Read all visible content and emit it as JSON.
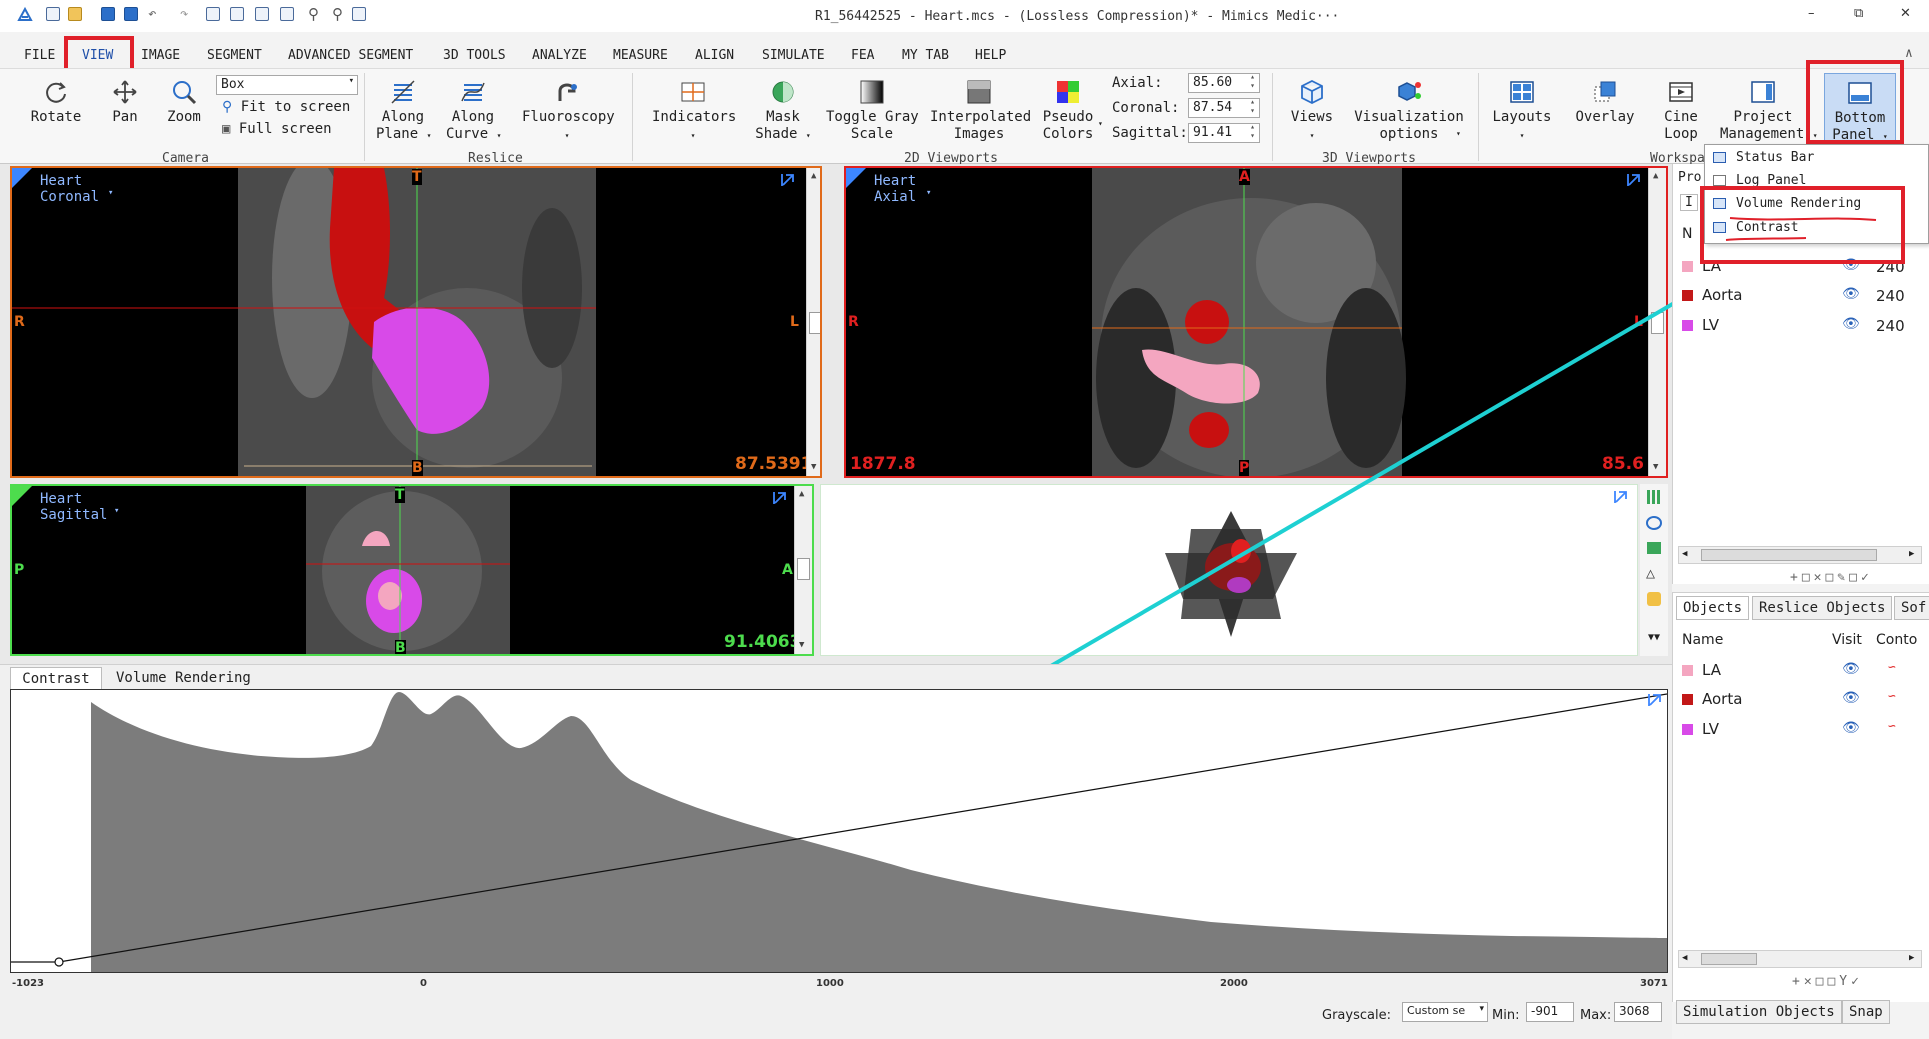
{
  "window": {
    "title": "R1_56442525 - Heart.mcs -  (Lossless Compression)* - Mimics Medic···",
    "minimize": "–",
    "restore": "⧉",
    "close": "✕",
    "collapse": "∧"
  },
  "menu": {
    "items": [
      "FILE",
      "VIEW",
      "IMAGE",
      "SEGMENT",
      "ADVANCED SEGMENT",
      "3D TOOLS",
      "ANALYZE",
      "MEASURE",
      "ALIGN",
      "SIMULATE",
      "FEA",
      "MY TAB",
      "HELP"
    ],
    "active": "VIEW"
  },
  "ribbon": {
    "camera": {
      "rotate": "Rotate",
      "pan": "Pan",
      "zoom": "Zoom",
      "zoom_mode": "Box",
      "fit": "Fit to screen",
      "full": "Full screen",
      "group": "Camera"
    },
    "reslice": {
      "along_plane_1": "Along",
      "along_plane_2": "Plane",
      "along_curve_1": "Along",
      "along_curve_2": "Curve",
      "fluoro": "Fluoroscopy",
      "group": "Reslice"
    },
    "viewports2d": {
      "indicators": "Indicators",
      "mask_1": "Mask",
      "mask_2": "Shade",
      "toggle_1": "Toggle Gray",
      "toggle_2": "Scale",
      "interp_1": "Interpolated",
      "interp_2": "Images",
      "pseudo_1": "Pseudo",
      "pseudo_2": "Colors",
      "axial_label": "Axial:",
      "axial": "85.60",
      "coronal_label": "Coronal:",
      "coronal": "87.54",
      "sagittal_label": "Sagittal:",
      "sagittal": "91.41",
      "group": "2D Viewports"
    },
    "viewports3d": {
      "views": "Views",
      "vis_1": "Visualization",
      "vis_2": "options",
      "group": "3D Viewports"
    },
    "workspace": {
      "layouts": "Layouts",
      "overlay": "Overlay",
      "cine_1": "Cine",
      "cine_2": "Loop",
      "proj_1": "Project",
      "proj_2": "Management",
      "bottom_1": "Bottom",
      "bottom_2": "Panel",
      "group": "Workspa"
    }
  },
  "popup": {
    "items": [
      "Status Bar",
      "Log Panel",
      "Volume Rendering",
      "Contrast"
    ]
  },
  "viewports": {
    "coronal": {
      "name": "Heart\nCoronal",
      "value": "87.5391",
      "top": "T",
      "bottom": "B",
      "left": "R",
      "right": "L"
    },
    "axial": {
      "name": "Heart\nAxial",
      "value_left": "1877.8",
      "value_right": "85.6",
      "top": "A",
      "bottom": "P",
      "left": "R",
      "right": "L"
    },
    "sagittal": {
      "name": "Heart\nSagittal",
      "value": "91.4063",
      "top": "T",
      "bottom": "B",
      "left": "P",
      "right": "A"
    }
  },
  "bottom_panel": {
    "tabs": [
      "Contrast",
      "Volume Rendering"
    ],
    "x_ticks": [
      "-1023",
      "0",
      "1000",
      "2000",
      "3071"
    ],
    "grayscale_label": "Grayscale:",
    "grayscale_value": "Custom se",
    "min_label": "Min:",
    "min": "-901",
    "max_label": "Max:",
    "max": "3068"
  },
  "masks_panel": {
    "top_label": "Pro",
    "tab2_label": "I",
    "header_first": "N",
    "rows": [
      {
        "name": "LA",
        "color": "#f4a6c0",
        "threshold": "240"
      },
      {
        "name": "Aorta",
        "color": "#c21818",
        "threshold": "240"
      },
      {
        "name": "LV",
        "color": "#d84ae8",
        "threshold": "240"
      }
    ]
  },
  "objects_panel": {
    "tabs": [
      "Objects",
      "Reslice Objects",
      "Sof"
    ],
    "headers": [
      "Name",
      "Visit",
      "Conto"
    ],
    "rows": [
      {
        "name": "LA",
        "color": "#f4a6c0"
      },
      {
        "name": "Aorta",
        "color": "#c21818"
      },
      {
        "name": "LV",
        "color": "#d84ae8"
      }
    ],
    "bottom_tabs": [
      "Simulation Objects",
      "Snap"
    ]
  }
}
